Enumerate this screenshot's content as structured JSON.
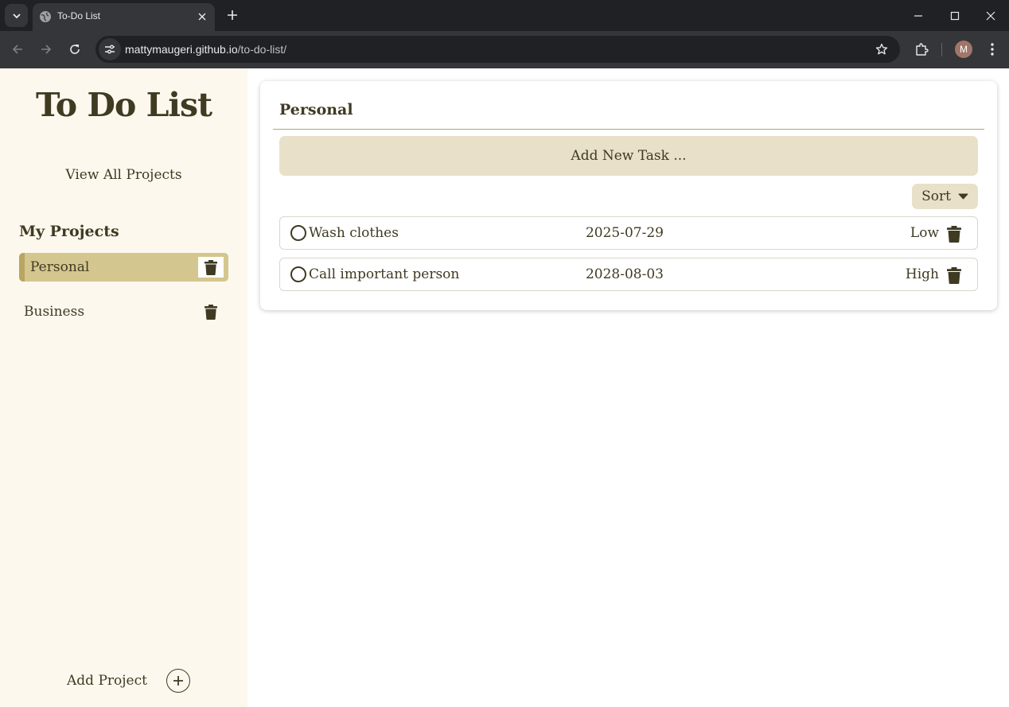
{
  "browser": {
    "tab_title": "To-Do List",
    "url_host": "mattymaugeri.github.io",
    "url_path": "/to-do-list/",
    "profile_initial": "M",
    "icons": [
      "tab-search-icon",
      "globe-icon",
      "close-icon",
      "plus-icon",
      "minimize-icon",
      "maximize-icon",
      "back-icon",
      "forward-icon",
      "reload-icon",
      "site-settings-icon",
      "star-icon",
      "extensions-icon",
      "more-vert-icon"
    ]
  },
  "sidebar": {
    "title": "To Do List",
    "view_all": "View All Projects",
    "section_title": "My Projects",
    "projects": [
      {
        "label": "Personal",
        "active": true
      },
      {
        "label": "Business",
        "active": false
      }
    ],
    "add_project": "Add Project"
  },
  "main": {
    "project_title": "Personal",
    "add_task": "Add New Task ...",
    "sort_label": "Sort",
    "tasks": [
      {
        "name": "Wash clothes",
        "date": "2025-07-29",
        "priority": "Low",
        "done": false
      },
      {
        "name": "Call important person",
        "date": "2028-08-03",
        "priority": "High",
        "done": false
      }
    ]
  },
  "colors": {
    "accent": "#d4c68f",
    "accent_border": "#b8a562",
    "text": "#3f3a22",
    "sidebar_bg": "#fdf8ed",
    "button_bg": "#e8e0c8"
  }
}
